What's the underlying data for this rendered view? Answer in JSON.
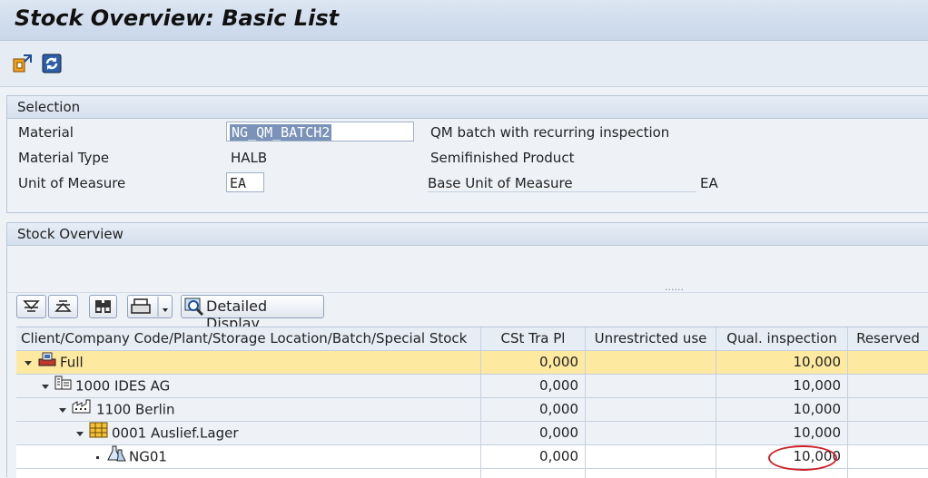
{
  "window": {
    "title": "Stock Overview: Basic List"
  },
  "toolbar": {
    "icons": [
      "display-change-icon",
      "refresh-icon"
    ]
  },
  "selection": {
    "header": "Selection",
    "material_label": "Material",
    "material_value": "NG_QM_BATCH2",
    "material_desc": "QM batch with recurring inspection",
    "type_label": "Material Type",
    "type_value": "HALB",
    "type_desc": "Semifinished Product",
    "uom_label": "Unit of Measure",
    "uom_value": "EA",
    "base_uom_label": "Base Unit of Measure",
    "base_uom_value": "EA"
  },
  "stock": {
    "header": "Stock Overview",
    "splitter": "......",
    "detailed_display_label": "Detailed Display",
    "columns": [
      "Client/Company Code/Plant/Storage Location/Batch/Special Stock",
      "CSt Tra Pl",
      "Unrestricted use",
      "Qual. inspection",
      "Reserved"
    ],
    "rows": [
      {
        "label": "Full",
        "cst": "0,000",
        "unrestricted": "",
        "qual": "10,000",
        "reserved": ""
      },
      {
        "label": "1000 IDES AG",
        "cst": "0,000",
        "unrestricted": "",
        "qual": "10,000",
        "reserved": ""
      },
      {
        "label": "1100 Berlin",
        "cst": "0,000",
        "unrestricted": "",
        "qual": "10,000",
        "reserved": ""
      },
      {
        "label": "0001 Auslief.Lager",
        "cst": "0,000",
        "unrestricted": "",
        "qual": "10,000",
        "reserved": ""
      },
      {
        "label": "NG01",
        "cst": "0,000",
        "unrestricted": "",
        "qual": "10,000",
        "reserved": ""
      }
    ]
  },
  "colors": {
    "highlight_row": "#fde9a0",
    "annotation": "#d0202a",
    "header_bg": "#d5e0ed"
  }
}
